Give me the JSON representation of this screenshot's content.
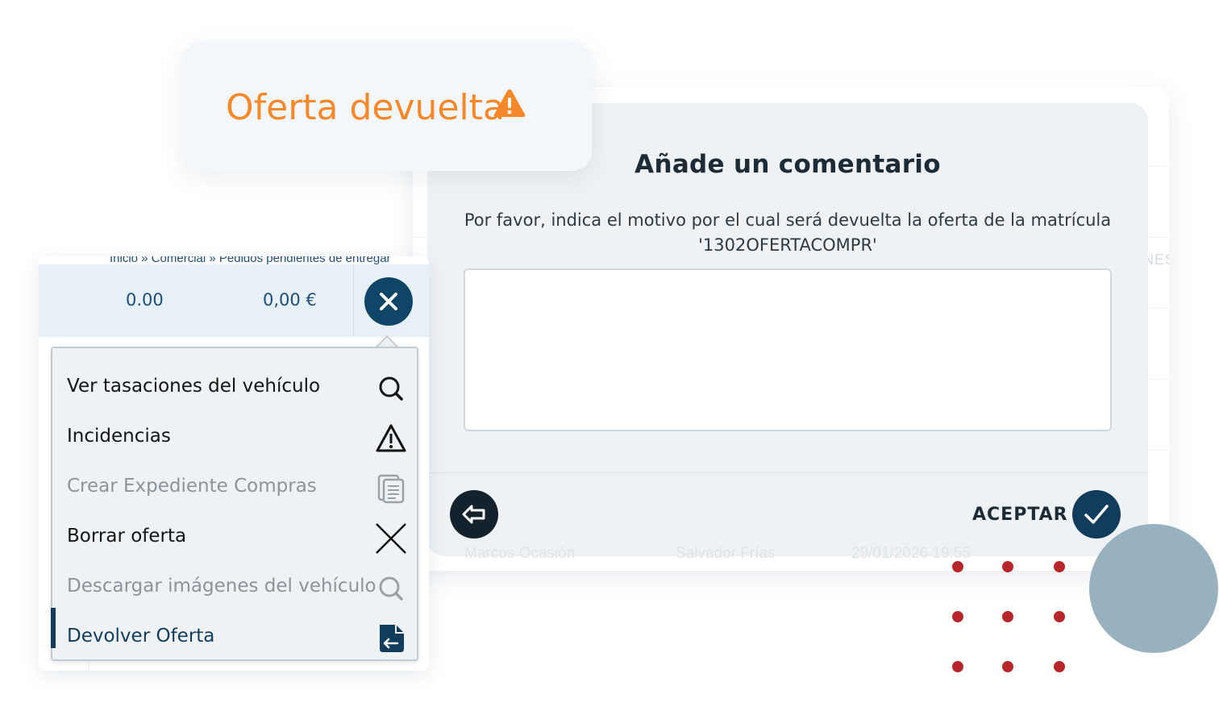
{
  "status_card": {
    "text": "Oferta devuelta",
    "icon": "warning-icon",
    "color": "#f5892a"
  },
  "dialog": {
    "title": "Añade un comentario",
    "message_line1": "Por favor, indica el motivo por el cual será devuelta la oferta de la matrícula",
    "message_line2": "'1302OFERTACOMPR'",
    "textarea_value": "",
    "back_icon": "arrow-left-icon",
    "accept_label": "ACEPTAR",
    "accept_icon": "check-icon"
  },
  "table": {
    "breadcrumb": "Inicio » Comercial » Pedidos pendientes de entregar",
    "row_value_1": "0.00",
    "row_value_2": "0,00 €",
    "close_icon": "close-icon",
    "bg_header_fragment": "NES",
    "bg_row": {
      "col1": "Marcos Ocasión",
      "col2": "Salvador Frías",
      "col3": "29/01/2026 19:55"
    }
  },
  "menu": {
    "items": [
      {
        "label": "Ver tasaciones del vehículo",
        "icon": "search-icon",
        "state": "enabled"
      },
      {
        "label": "Incidencias",
        "icon": "warning-icon",
        "state": "enabled"
      },
      {
        "label": "Crear Expediente Compras",
        "icon": "document-icon",
        "state": "disabled"
      },
      {
        "label": "Borrar oferta",
        "icon": "close-icon",
        "state": "enabled"
      },
      {
        "label": "Descargar imágenes del vehículo",
        "icon": "search-icon",
        "state": "disabled"
      },
      {
        "label": "Devolver Oferta",
        "icon": "return-document-icon",
        "state": "active"
      }
    ]
  },
  "colors": {
    "primary": "#123c5c",
    "accent_orange": "#f5892a",
    "dark_button": "#14222e",
    "decor_red": "#b8262c",
    "decor_circle": "#97b1bf"
  }
}
